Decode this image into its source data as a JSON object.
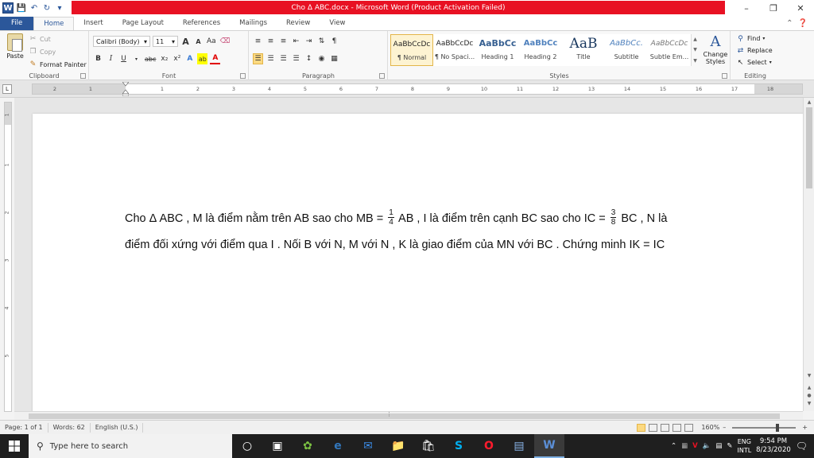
{
  "titlebar": {
    "title": "Cho Δ ABC.docx  -  Microsoft Word (Product Activation Failed)",
    "app_icon": "W",
    "controls": [
      "–",
      "❐",
      "✕"
    ]
  },
  "tabs": [
    {
      "label": "File"
    },
    {
      "label": "Home"
    },
    {
      "label": "Insert"
    },
    {
      "label": "Page Layout"
    },
    {
      "label": "References"
    },
    {
      "label": "Mailings"
    },
    {
      "label": "Review"
    },
    {
      "label": "View"
    }
  ],
  "ribbon": {
    "clipboard": {
      "label": "Clipboard",
      "paste": "Paste",
      "cut": "Cut",
      "copy": "Copy",
      "format_painter": "Format Painter"
    },
    "font": {
      "label": "Font",
      "font_name": "Calibri (Body)",
      "font_size": "11",
      "grow": "A",
      "shrink": "A",
      "change_case": "Aa",
      "bold": "B",
      "italic": "I",
      "underline": "U",
      "strike": "abc",
      "subscript": "x₂",
      "superscript": "x²",
      "effects": "A",
      "highlight": "ab",
      "font_color": "A"
    },
    "paragraph": {
      "label": "Paragraph",
      "pilcrow": "¶"
    },
    "styles": {
      "label": "Styles",
      "items": [
        {
          "sample": "AaBbCcDc",
          "name": "¶ Normal"
        },
        {
          "sample": "AaBbCcDc",
          "name": "¶ No Spaci..."
        },
        {
          "sample": "AaBbCc",
          "name": "Heading 1"
        },
        {
          "sample": "AaBbCc",
          "name": "Heading 2"
        },
        {
          "sample": "AaB",
          "name": "Title"
        },
        {
          "sample": "AaBbCc.",
          "name": "Subtitle"
        },
        {
          "sample": "AaBbCcDc",
          "name": "Subtle Em..."
        }
      ],
      "change_styles": "Change Styles",
      "change_styles_icon": "A"
    },
    "editing": {
      "label": "Editing",
      "find": "Find",
      "replace": "Replace",
      "select": "Select"
    }
  },
  "ruler": {
    "numbers": [
      "2",
      "1",
      "1",
      "2",
      "3",
      "4",
      "5",
      "6",
      "7",
      "8",
      "9",
      "10",
      "11",
      "12",
      "13",
      "14",
      "15",
      "16",
      "17",
      "18"
    ],
    "corner": "L",
    "vertical_numbers": [
      "1",
      "1",
      "2",
      "3",
      "4",
      "5"
    ]
  },
  "document": {
    "line1_a": "Cho Δ ABC , M là điểm nằm trên AB sao cho MB = ",
    "frac1_num": "1",
    "frac1_den": "4",
    "line1_b": " AB , I là điểm trên cạnh BC sao cho IC = ",
    "frac2_num": "3",
    "frac2_den": "8",
    "line1_c": " BC , N là",
    "line2": "điểm đối xứng với điểm qua I . Nối B với N, M với N , K là giao điểm của MN với BC . Chứng minh IK = IC"
  },
  "statusbar": {
    "page": "Page: 1 of 1",
    "words": "Words: 62",
    "language": "English (U.S.)",
    "zoom": "160%",
    "zoom_minus": "–",
    "zoom_plus": "+"
  },
  "taskbar": {
    "search_placeholder": "Type here to search",
    "lang_top": "ENG",
    "lang_bottom": "INTL",
    "time": "9:54 PM",
    "date": "8/23/2020"
  },
  "colors": {
    "accent": "#2b579a",
    "title_alert": "#e81123",
    "selected": "#fcd981"
  }
}
